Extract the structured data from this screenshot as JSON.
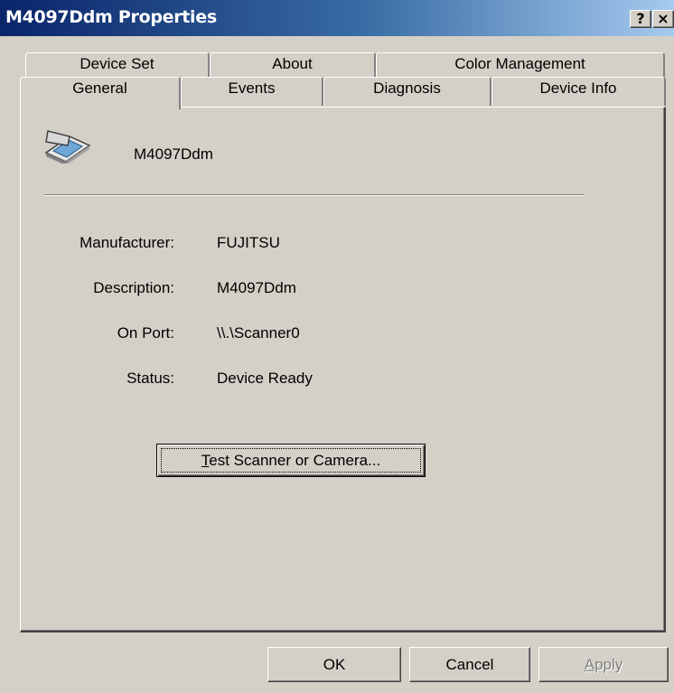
{
  "window": {
    "title": "M4097Ddm Properties",
    "help_glyph": "?",
    "close_glyph": "×"
  },
  "tabs": {
    "row1": [
      "Device Set",
      "About",
      "Color Management"
    ],
    "row2": [
      "General",
      "Events",
      "Diagnosis",
      "Device Info"
    ],
    "active": "General"
  },
  "device": {
    "icon": "scanner-icon",
    "name": "M4097Ddm"
  },
  "properties": [
    {
      "label": "Manufacturer:",
      "value": "FUJITSU"
    },
    {
      "label": "Description:",
      "value": "M4097Ddm"
    },
    {
      "label": "On Port:",
      "value": "\\\\.\\Scanner0"
    },
    {
      "label": "Status:",
      "value": "Device Ready"
    }
  ],
  "test_button": {
    "mnemonic": "T",
    "rest": "est Scanner or Camera..."
  },
  "buttons": {
    "ok": "OK",
    "cancel": "Cancel",
    "apply_mnemonic": "A",
    "apply_rest": "pply"
  },
  "colors": {
    "title_gradient_start": "#0a246a",
    "title_gradient_end": "#a6caf0",
    "face": "#d4d0c8"
  }
}
